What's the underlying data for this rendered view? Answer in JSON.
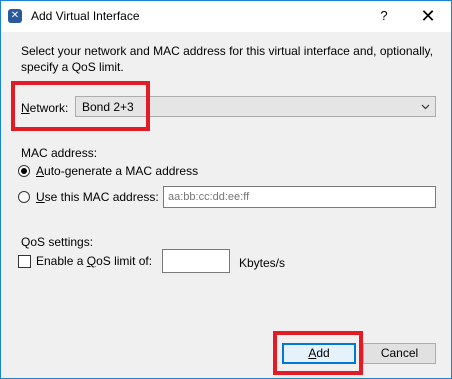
{
  "window": {
    "title": "Add Virtual Interface",
    "help_glyph": "?",
    "close_glyph": "✕",
    "app_icon_glyph": "✕"
  },
  "intro_text": "Select your network and MAC address for this virtual interface and, optionally, specify a QoS limit.",
  "network": {
    "label_mnemonic": "N",
    "label_rest": "etwork:",
    "selected": "Bond 2+3"
  },
  "mac": {
    "section_label": "MAC address:",
    "auto_option": {
      "mnemonic": "A",
      "rest": "uto-generate a MAC address",
      "checked": true
    },
    "manual_option": {
      "mnemonic": "U",
      "rest": "se this MAC address:",
      "checked": false
    },
    "input_placeholder": "aa:bb:cc:dd:ee:ff"
  },
  "qos": {
    "section_label": "QoS settings:",
    "checkbox_prefix": "Enable a ",
    "checkbox_mnemonic": "Q",
    "checkbox_rest": "oS limit of:",
    "checked": false,
    "input_value": "",
    "unit": "Kbytes/s"
  },
  "buttons": {
    "add": {
      "mnemonic": "A",
      "rest": "dd"
    },
    "cancel": "Cancel"
  },
  "colors": {
    "highlight": "#e31b24",
    "accent": "#0078d7"
  },
  "icons": [
    "app-icon",
    "help-icon",
    "close-icon",
    "chevron-down-icon"
  ]
}
